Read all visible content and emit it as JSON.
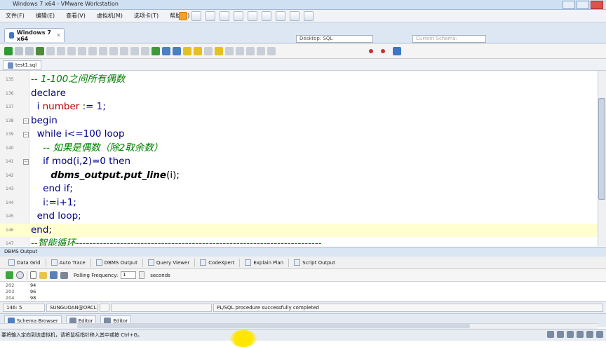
{
  "window": {
    "title": "Windows 7 x64 - VMware Workstation"
  },
  "menubar": {
    "items": [
      "文件(F)",
      "编辑(E)",
      "查看(V)",
      "虚拟机(M)",
      "选项卡(T)",
      "帮助(H)"
    ]
  },
  "vm_tab": {
    "label": "Windows 7 x64"
  },
  "toolbar": {
    "desktop_combo": "Desktop: SQL",
    "schema_combo": "Current Schema:"
  },
  "file_tab": {
    "label": "test1.sql"
  },
  "editor": {
    "lines": [
      {
        "num": "135",
        "text": "-- 1-100之间所有偶数"
      },
      {
        "num": "136",
        "text": "declare"
      },
      {
        "num": "137",
        "indent": "  i ",
        "type": "number",
        "rest": " := 1;"
      },
      {
        "num": "138",
        "text": "begin"
      },
      {
        "num": "139",
        "text": "  while i<=100 loop"
      },
      {
        "num": "140",
        "text": "    -- 如果是偶数（除2取余数）"
      },
      {
        "num": "141",
        "text": "    if mod(i,2)=0 then"
      },
      {
        "num": "142",
        "fn": "      dbms_output.put_line",
        "rest": "(i);"
      },
      {
        "num": "143",
        "text": "    end if;"
      },
      {
        "num": "144",
        "text": "    i:=i+1;"
      },
      {
        "num": "145",
        "text": "  end loop;"
      },
      {
        "num": "146",
        "text": "end;"
      },
      {
        "num": "147",
        "text": "--智能循环------------------------------------------------------------------------"
      }
    ]
  },
  "dbms_output": {
    "header": "DBMS Output",
    "tabs": [
      "Data Grid",
      "Auto Trace",
      "DBMS Output",
      "Query Viewer",
      "CodeXpert",
      "Explain Plan",
      "Script Output"
    ],
    "polling_label": "Polling Frequency:",
    "polling_value": "1",
    "polling_unit": "seconds",
    "rows": [
      {
        "num": "202",
        "val": "94"
      },
      {
        "num": "203",
        "val": "96"
      },
      {
        "num": "204",
        "val": "98"
      }
    ]
  },
  "statusbar": {
    "position": "146:  5",
    "connection": "SUNGUOAN@ORCL",
    "message": "PL/SQL procedure successfully completed"
  },
  "bottom_tabs": [
    "Schema Browser",
    "Editor",
    "Editor"
  ],
  "vm_status": "要将输入定向到该虚拟机，请将鼠标指针移入其中或按 Ctrl+G。"
}
